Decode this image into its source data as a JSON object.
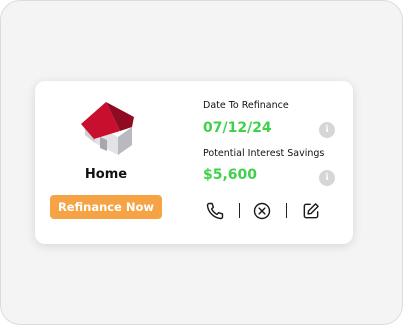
{
  "card": {
    "title": "Home",
    "action_button": "Refinance Now",
    "date_label": "Date To Refinance",
    "date_value": "07/12/24",
    "savings_label": "Potential Interest Savings",
    "savings_value": "$5,600",
    "info_glyph": "i"
  },
  "icons": {
    "house": "house-icon",
    "phone": "phone-icon",
    "cancel": "close-circle-icon",
    "edit": "edit-icon"
  },
  "colors": {
    "roof": "#c8102e",
    "accent_orange": "#f5a344",
    "value_green": "#3fd14a"
  }
}
